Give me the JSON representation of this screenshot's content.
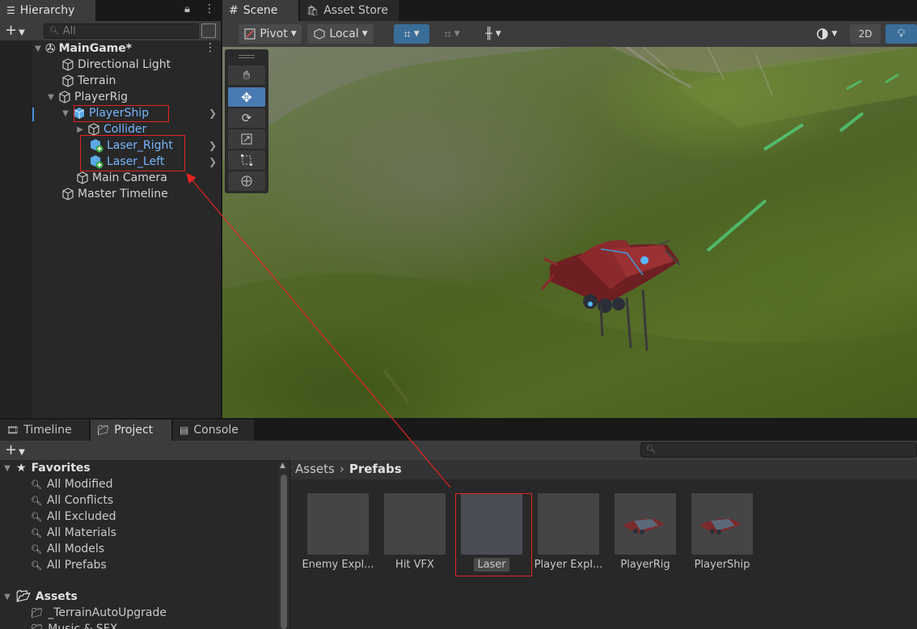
{
  "hierarchy": {
    "tab_label": "Hierarchy",
    "search_placeholder": "All",
    "scene_name": "MainGame*",
    "items": [
      {
        "label": "Directional Light"
      },
      {
        "label": "Terrain"
      },
      {
        "label": "PlayerRig"
      },
      {
        "label": "PlayerShip"
      },
      {
        "label": "Collider"
      },
      {
        "label": "Laser_Right"
      },
      {
        "label": "Laser_Left"
      },
      {
        "label": "Main Camera"
      },
      {
        "label": "Master Timeline"
      }
    ]
  },
  "scene": {
    "tabs": [
      {
        "label": "Scene"
      },
      {
        "label": "Asset Store"
      }
    ],
    "toolbar": {
      "pivot": "Pivot",
      "local": "Local",
      "mode_2d": "2D"
    }
  },
  "project": {
    "tabs": [
      {
        "label": "Timeline"
      },
      {
        "label": "Project"
      },
      {
        "label": "Console"
      }
    ],
    "favorites_label": "Favorites",
    "favorites": [
      "All Modified",
      "All Conflicts",
      "All Excluded",
      "All Materials",
      "All Models",
      "All Prefabs"
    ],
    "assets_label": "Assets",
    "folders": [
      "_TerrainAutoUpgrade",
      "Music & SFX"
    ],
    "breadcrumb": {
      "root": "Assets",
      "current": "Prefabs"
    },
    "assets": [
      "Enemy Expl...",
      "Hit VFX",
      "Laser",
      "Player Expl...",
      "PlayerRig",
      "PlayerShip"
    ]
  },
  "colors": {
    "accent": "#4a7ab3",
    "selection_text": "#78b6ff",
    "highlight_box": "#e52222"
  }
}
